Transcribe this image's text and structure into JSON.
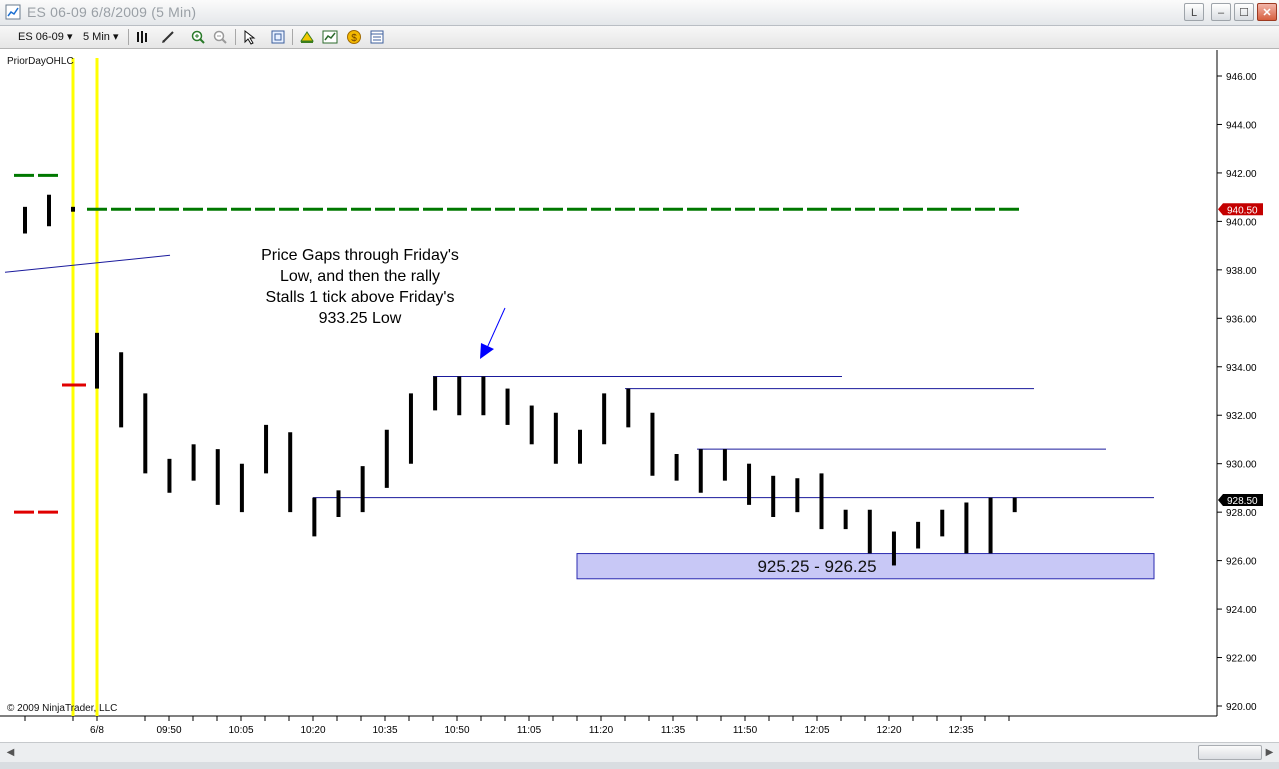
{
  "window": {
    "title": "ES 06-09  6/8/2009 (5 Min)",
    "buttons": {
      "link": "L",
      "minimize": "–",
      "maximize": "☐",
      "close": "✕"
    }
  },
  "toolbar": {
    "instrument": "ES 06-09",
    "interval": "5 Min",
    "icons": [
      "bar-type-icon",
      "draw-pencil-icon",
      "zoom-in-icon",
      "zoom-out-icon",
      "pointer-icon",
      "properties-icon",
      "strategy-icon",
      "indicators-icon",
      "coin-icon",
      "data-box-icon"
    ]
  },
  "chart": {
    "indicator_label": "PriorDayOHLC",
    "copyright": "© 2009 NinjaTrader, LLC",
    "annotation_lines": [
      "Price Gaps through Friday's",
      "Low, and then the rally",
      "Stalls 1 tick above Friday's",
      "933.25 Low"
    ],
    "zone_label": "925.25 - 926.25",
    "price_marker_high": "940.50",
    "price_marker_last": "928.50",
    "colors": {
      "up_down_bars": "#000000",
      "green_line": "#007800",
      "red_mark": "#e00000",
      "session_line": "#ffff00",
      "hline": "#1a1a9c",
      "zone_fill": "#c8c8f6",
      "arrow": "#0000ff"
    }
  },
  "chart_data": {
    "type": "ohlc",
    "y_axis": {
      "min": 920,
      "max": 946,
      "ticks": [
        "920.00",
        "922.00",
        "924.00",
        "926.00",
        "928.00",
        "930.00",
        "932.00",
        "934.00",
        "936.00",
        "938.00",
        "940.00",
        "942.00",
        "944.00",
        "946.00"
      ]
    },
    "x_ticks": [
      "6/8",
      "09:50",
      "10:05",
      "10:20",
      "10:35",
      "10:50",
      "11:05",
      "11:20",
      "11:35",
      "11:50",
      "12:05",
      "12:20",
      "12:35"
    ],
    "prior_bars": [
      {
        "low": 939.5,
        "high": 940.6
      },
      {
        "low": 939.8,
        "high": 941.1
      },
      {
        "low": 940.4,
        "high": 940.6
      }
    ],
    "bars": [
      {
        "low": 933.1,
        "high": 935.4
      },
      {
        "low": 931.5,
        "high": 934.6
      },
      {
        "low": 929.6,
        "high": 932.9
      },
      {
        "low": 928.8,
        "high": 930.2
      },
      {
        "low": 929.3,
        "high": 930.8
      },
      {
        "low": 928.3,
        "high": 930.6
      },
      {
        "low": 928.0,
        "high": 930.0
      },
      {
        "low": 929.6,
        "high": 931.6
      },
      {
        "low": 928.0,
        "high": 931.3
      },
      {
        "low": 927.0,
        "high": 928.6
      },
      {
        "low": 927.8,
        "high": 928.9
      },
      {
        "low": 928.0,
        "high": 929.9
      },
      {
        "low": 929.0,
        "high": 931.4
      },
      {
        "low": 930.0,
        "high": 932.9
      },
      {
        "low": 932.2,
        "high": 933.6
      },
      {
        "low": 932.0,
        "high": 933.6
      },
      {
        "low": 932.0,
        "high": 933.6
      },
      {
        "low": 931.6,
        "high": 933.1
      },
      {
        "low": 930.8,
        "high": 932.4
      },
      {
        "low": 930.0,
        "high": 932.1
      },
      {
        "low": 930.0,
        "high": 931.4
      },
      {
        "low": 930.8,
        "high": 932.9
      },
      {
        "low": 931.5,
        "high": 933.1
      },
      {
        "low": 929.5,
        "high": 932.1
      },
      {
        "low": 929.3,
        "high": 930.4
      },
      {
        "low": 928.8,
        "high": 930.6
      },
      {
        "low": 929.3,
        "high": 930.6
      },
      {
        "low": 928.3,
        "high": 930.0
      },
      {
        "low": 927.8,
        "high": 929.5
      },
      {
        "low": 928.0,
        "high": 929.4
      },
      {
        "low": 927.3,
        "high": 929.6
      },
      {
        "low": 927.3,
        "high": 928.1
      },
      {
        "low": 926.3,
        "high": 928.1
      },
      {
        "low": 925.8,
        "high": 927.2
      },
      {
        "low": 926.5,
        "high": 927.6
      },
      {
        "low": 927.0,
        "high": 928.1
      },
      {
        "low": 926.3,
        "high": 928.4
      },
      {
        "low": 926.3,
        "high": 928.6
      },
      {
        "low": 928.0,
        "high": 928.6
      }
    ],
    "prior_day_levels": {
      "high": 940.5,
      "close": 933.25,
      "low": 928.0,
      "open_mark": 941.9
    },
    "horizontal_levels": [
      933.6,
      933.1,
      930.6,
      928.6
    ],
    "support_zone": [
      925.25,
      926.25
    ]
  }
}
